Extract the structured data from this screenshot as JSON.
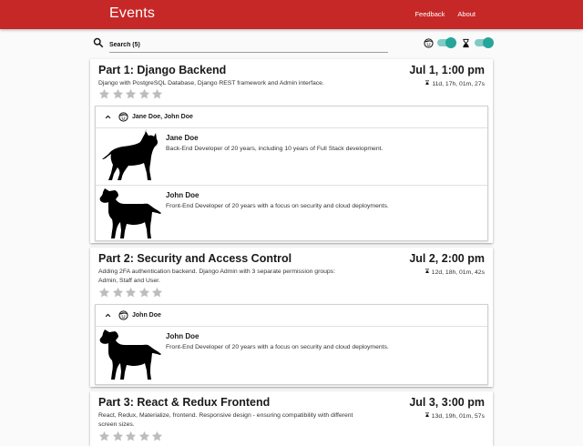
{
  "app": {
    "title": "Events",
    "nav": [
      "Feedback",
      "About"
    ]
  },
  "search": {
    "value": "Search (5)"
  },
  "toggles": [
    {
      "icon": "face-icon",
      "state": "on"
    },
    {
      "icon": "hourglass-icon",
      "state": "on"
    }
  ],
  "colors": {
    "appbar": "#c62828",
    "accent": "#26a69a",
    "star": "#bdbdbd"
  },
  "events": [
    {
      "title": "Part 1: Django Backend",
      "date": "Jul 1, 1:00 pm",
      "description": "Django with PostgreSQL Database, Django REST framework and Admin interface.",
      "countdown": "11d, 17h, 01m, 27s",
      "rating": 0,
      "speakers_label": "Jane Doe, John Doe",
      "speakers": [
        {
          "name": "Jane Doe",
          "bio": "Back-End Developer of 20 years, including 10 years of Full Stack development.",
          "avatar": "cat-silhouette"
        },
        {
          "name": "John Doe",
          "bio": "Front-End Developer of 20 years with a focus on security and cloud deployments.",
          "avatar": "dog-silhouette"
        }
      ]
    },
    {
      "title": "Part 2: Security and Access Control",
      "date": "Jul 2, 2:00 pm",
      "description": "Adding 2FA authentication backend. Django Admin with 3 separate permission groups: Admin, Staff and User.",
      "countdown": "12d, 18h, 01m, 42s",
      "rating": 0,
      "speakers_label": "John Doe",
      "speakers": [
        {
          "name": "John Doe",
          "bio": "Front-End Developer of 20 years with a focus on security and cloud deployments.",
          "avatar": "dog-silhouette"
        }
      ]
    },
    {
      "title": "Part 3: React & Redux Frontend",
      "date": "Jul 3, 3:00 pm",
      "description": "React, Redux, Materialize, frontend. Responsive design - ensuring compatibility with different screen sizes.",
      "countdown": "13d, 19h, 01m, 57s",
      "rating": 0
    }
  ]
}
